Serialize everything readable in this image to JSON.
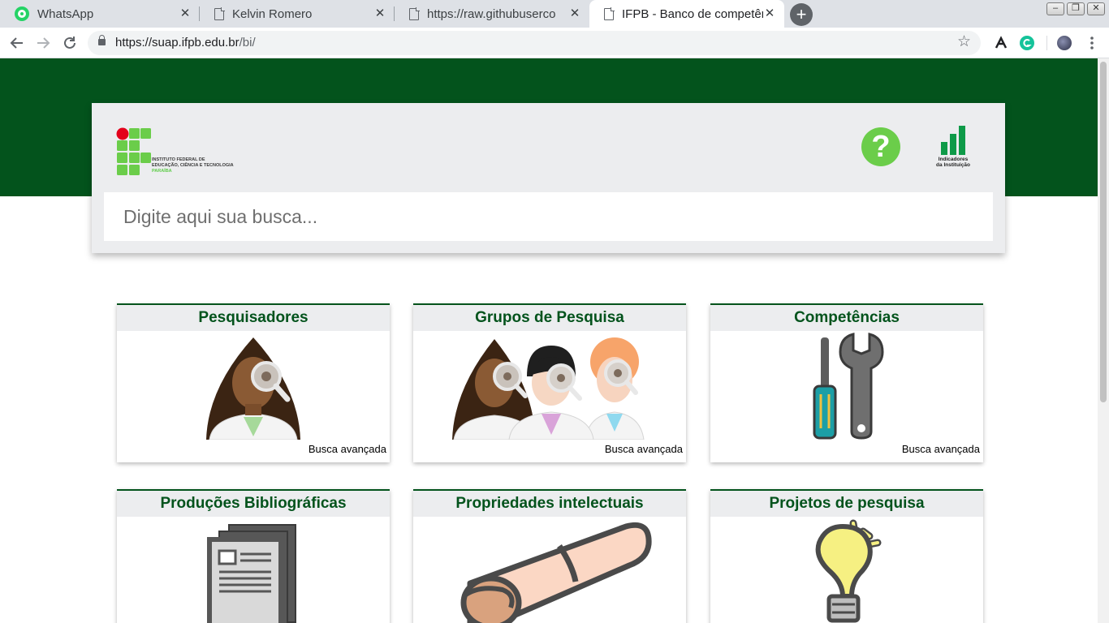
{
  "browser": {
    "tabs": [
      {
        "label": "WhatsApp",
        "icon": "whatsapp-icon"
      },
      {
        "label": "Kelvin Romero",
        "icon": "document-icon"
      },
      {
        "label": "https://raw.githubuserco",
        "icon": "document-icon"
      },
      {
        "label": "IFPB - Banco de competên",
        "icon": "document-icon",
        "active": true
      }
    ],
    "close_glyph": "✕",
    "new_tab_glyph": "+",
    "url_host": "https://suap.ifpb.edu.br",
    "url_path": "/bi/",
    "window_controls": [
      "–",
      "❐",
      "✕"
    ]
  },
  "header": {
    "logo_lines": [
      "INSTITUTO FEDERAL DE",
      "EDUCAÇÃO, CIÊNCIA E TECNOLOGIA",
      "PARAÍBA"
    ],
    "help_glyph": "?",
    "indicators_lines": [
      "Indicadores",
      "da Instituição"
    ],
    "search_placeholder": "Digite aqui sua busca..."
  },
  "cards": [
    {
      "title": "Pesquisadores",
      "link": "Busca avançada",
      "icon": "researcher-icon"
    },
    {
      "title": "Grupos de Pesquisa",
      "link": "Busca avançada",
      "icon": "research-group-icon"
    },
    {
      "title": "Competências",
      "link": "Busca avançada",
      "icon": "tools-icon"
    },
    {
      "title": "Produções Bibliográficas",
      "link": "",
      "icon": "documents-icon"
    },
    {
      "title": "Propriedades intelectuais",
      "link": "",
      "icon": "scroll-icon"
    },
    {
      "title": "Projetos de pesquisa",
      "link": "",
      "icon": "lightbulb-icon"
    }
  ],
  "colors": {
    "brand_green": "#03531c",
    "logo_green": "#6bcd4a",
    "logo_red": "#e3001b",
    "card_header_bg": "#ecedef"
  }
}
